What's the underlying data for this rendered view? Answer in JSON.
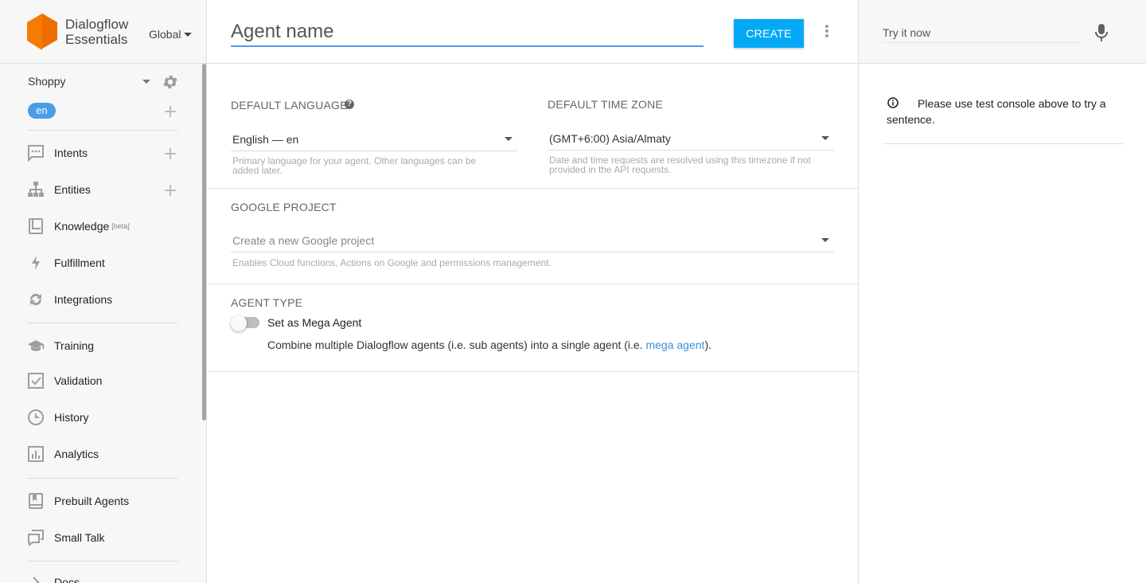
{
  "brand": {
    "line1": "Dialogflow",
    "line2": "Essentials",
    "region": "Global",
    "logo_color": "#f57c00"
  },
  "sidebar": {
    "agent": "Shoppy",
    "language": "en",
    "items": [
      {
        "label": "Intents",
        "icon": "chat-icon",
        "has_add": true
      },
      {
        "label": "Entities",
        "icon": "hierarchy-icon",
        "has_add": true
      },
      {
        "label": "Knowledge",
        "superscript": "[beta]",
        "icon": "book-icon"
      },
      {
        "label": "Fulfillment",
        "icon": "bolt-icon"
      },
      {
        "label": "Integrations",
        "icon": "sync-icon"
      },
      {
        "label": "Training",
        "icon": "graduation-cap-icon"
      },
      {
        "label": "Validation",
        "icon": "checkbox-icon"
      },
      {
        "label": "History",
        "icon": "clock-icon"
      },
      {
        "label": "Analytics",
        "icon": "bar-chart-icon"
      },
      {
        "label": "Prebuilt Agents",
        "icon": "bookmark-book-icon"
      },
      {
        "label": "Small Talk",
        "icon": "chat-bubbles-icon"
      },
      {
        "label": "Docs",
        "icon": "chevron-right-icon"
      }
    ]
  },
  "main": {
    "agent_name_placeholder": "Agent name",
    "create_label": "CREATE",
    "default_language": {
      "title": "DEFAULT LANGUAGE",
      "help": "?",
      "value": "English — en",
      "hint": "Primary language for your agent. Other languages can be added later."
    },
    "default_timezone": {
      "title": "DEFAULT TIME ZONE",
      "value": "(GMT+6:00) Asia/Almaty",
      "hint": "Date and time requests are resolved using this timezone if not provided in the API requests."
    },
    "google_project": {
      "title": "GOOGLE PROJECT",
      "placeholder": "Create a new Google project",
      "hint": "Enables Cloud functions, Actions on Google and permissions management."
    },
    "agent_type": {
      "title": "AGENT TYPE",
      "toggle_label": "Set as Mega Agent",
      "toggle_on": false,
      "desc_before": "Combine multiple Dialogflow agents (i.e. sub agents) into a single agent (i.e. ",
      "desc_link": "mega agent",
      "desc_after": ")."
    }
  },
  "console": {
    "placeholder": "Try it now",
    "info": "Please use test console above to try a sentence."
  },
  "colors": {
    "accent": "#03a9f4",
    "underline": "#4a9de7",
    "link": "#3b8fd6"
  }
}
